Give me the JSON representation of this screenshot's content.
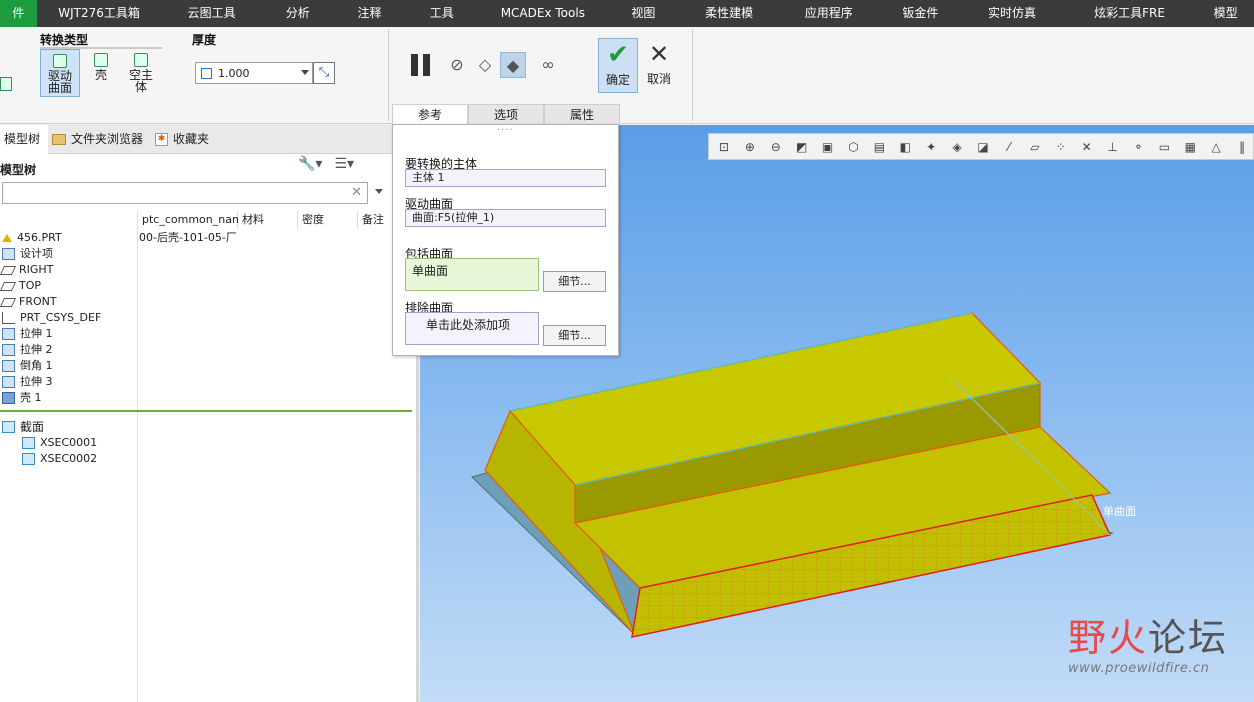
{
  "menu": {
    "items": [
      "件",
      "WJT276工具箱",
      "云图工具",
      "分析",
      "注释",
      "工具",
      "MCADEx Tools",
      "视图",
      "柔性建模",
      "应用程序",
      "钣金件",
      "实时仿真",
      "炫彩工具FRE",
      "模型"
    ],
    "active_index": 0
  },
  "ribbon": {
    "convert_type_title": "转换类型",
    "convert_options": [
      "驱动曲面",
      "壳",
      "空主体"
    ],
    "thickness_title": "厚度",
    "thickness_value": "1.000",
    "ok_label": "确定",
    "cancel_label": "取消",
    "tabs": [
      "参考",
      "选项",
      "属性"
    ],
    "active_tab": "参考"
  },
  "left_panel": {
    "tabs": [
      "模型树",
      "文件夹浏览器",
      "收藏夹"
    ],
    "tree_title": "模型树",
    "columns": [
      "ptc_common_name",
      "材料",
      "密度",
      "备注"
    ],
    "root_common_name": "00-后壳-101-05-厂",
    "nodes": [
      {
        "label": "456.PRT",
        "icon": "part-icon"
      },
      {
        "label": "设计项",
        "icon": "design-items-icon"
      },
      {
        "label": "RIGHT",
        "icon": "datum-plane-icon"
      },
      {
        "label": "TOP",
        "icon": "datum-plane-icon"
      },
      {
        "label": "FRONT",
        "icon": "datum-plane-icon"
      },
      {
        "label": "PRT_CSYS_DEF",
        "icon": "coordinate-system-icon"
      },
      {
        "label": "拉伸 1",
        "icon": "extrude-icon"
      },
      {
        "label": "拉伸 2",
        "icon": "extrude-icon"
      },
      {
        "label": "倒角 1",
        "icon": "chamfer-icon"
      },
      {
        "label": "拉伸 3",
        "icon": "extrude-icon"
      },
      {
        "label": "壳 1",
        "icon": "shell-icon"
      }
    ],
    "sections_label": "截面",
    "sections": [
      "XSEC0001",
      "XSEC0002"
    ]
  },
  "ref_panel": {
    "body_label": "要转换的主体",
    "body_value": "主体 1",
    "drive_label": "驱动曲面",
    "drive_value": "曲面:F5(拉伸_1)",
    "include_label": "包括曲面",
    "include_value": "单曲面",
    "exclude_label": "排除曲面",
    "exclude_placeholder": "单击此处添加项",
    "detail_label": "细节..."
  },
  "graphics": {
    "surface_label": "单曲面"
  },
  "watermark": {
    "logo_part1": "野火",
    "logo_part2": "论坛",
    "url": "www.proewildfire.cn"
  },
  "colors": {
    "menu_bg": "#3b3b3b",
    "menu_active": "#1e9b3e",
    "model_face": "#c8c800",
    "model_edge": "#e8590c",
    "viewport_top": "#5a9de8"
  }
}
